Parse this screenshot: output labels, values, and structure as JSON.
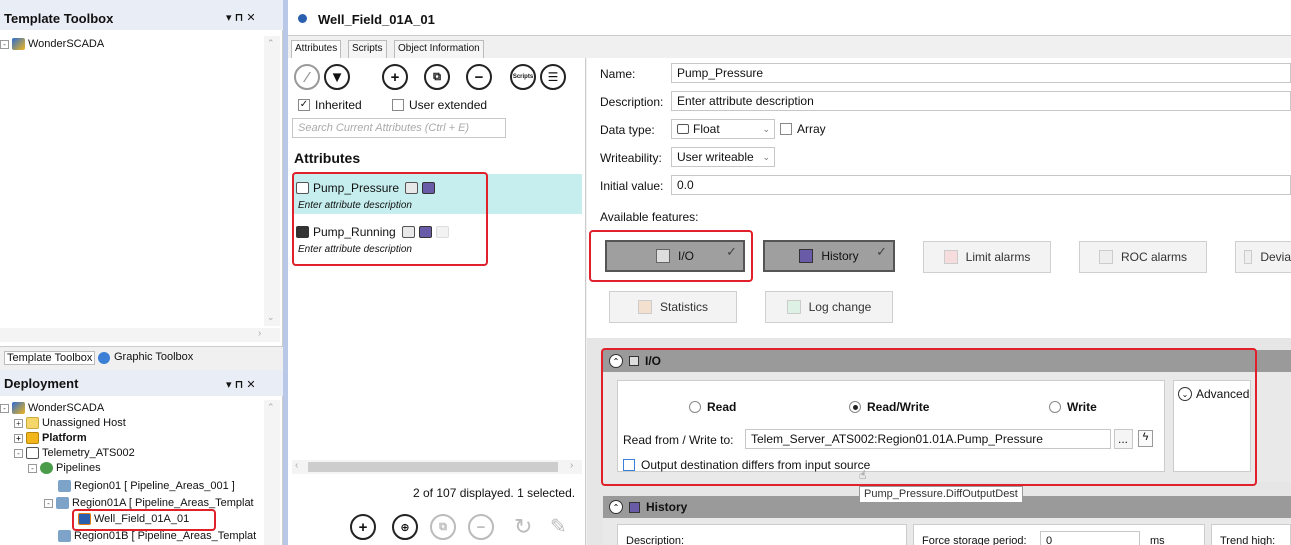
{
  "template_toolbox": {
    "title": "Template Toolbox",
    "pin": "▾ ⊓ ✕",
    "root": "WonderSCADA",
    "tabs": [
      "Template Toolbox",
      "Graphic Toolbox"
    ]
  },
  "deployment": {
    "title": "Deployment",
    "pin": "▾ ⊓ ✕",
    "items": [
      "WonderSCADA",
      "Unassigned Host",
      "Platform",
      "Telemetry_ATS002",
      "Pipelines",
      "Region01 [ Pipeline_Areas_001 ]",
      "Region01A [ Pipeline_Areas_Templat",
      "Well_Field_01A_01",
      "Region01B [ Pipeline_Areas_Templat"
    ]
  },
  "editor": {
    "title": "Well_Field_01A_01",
    "tabs": [
      "Attributes",
      "Scripts",
      "Object Information"
    ],
    "toolbar_scripts": "Scripts",
    "inherited_label": "Inherited",
    "user_extended_label": "User extended",
    "search_placeholder": "Search Current Attributes (Ctrl + E)",
    "attributes_heading": "Attributes",
    "attributes": [
      {
        "name": "Pump_Pressure",
        "desc": "Enter attribute description"
      },
      {
        "name": "Pump_Running",
        "desc": "Enter attribute description"
      }
    ],
    "status": "2 of 107 displayed. 1 selected."
  },
  "details": {
    "name_label": "Name:",
    "name_value": "Pump_Pressure",
    "description_label": "Description:",
    "description_value": "Enter attribute description",
    "datatype_label": "Data type:",
    "datatype_value": "Float",
    "array_label": "Array",
    "writeability_label": "Writeability:",
    "writeability_value": "User writeable",
    "initial_label": "Initial value:",
    "initial_value": "0.0",
    "features_label": "Available features:",
    "features": [
      "I/O",
      "History",
      "Limit alarms",
      "ROC alarms",
      "Devia",
      "Statistics",
      "Log change"
    ]
  },
  "io_section": {
    "title": "I/O",
    "read": "Read",
    "read_write": "Read/Write",
    "write": "Write",
    "advanced": "Advanced",
    "read_from_label": "Read from / Write to:",
    "read_from_value": "Telem_Server_ATS002:Region01.01A.Pump_Pressure",
    "browse": "...",
    "output_differs": "Output destination differs from input source",
    "tooltip": "Pump_Pressure.DiffOutputDest"
  },
  "history_section": {
    "title": "History",
    "description_label": "Description:",
    "force_label": "Force storage period:",
    "force_value": "0",
    "force_unit": "ms",
    "trend_label": "Trend high:"
  }
}
